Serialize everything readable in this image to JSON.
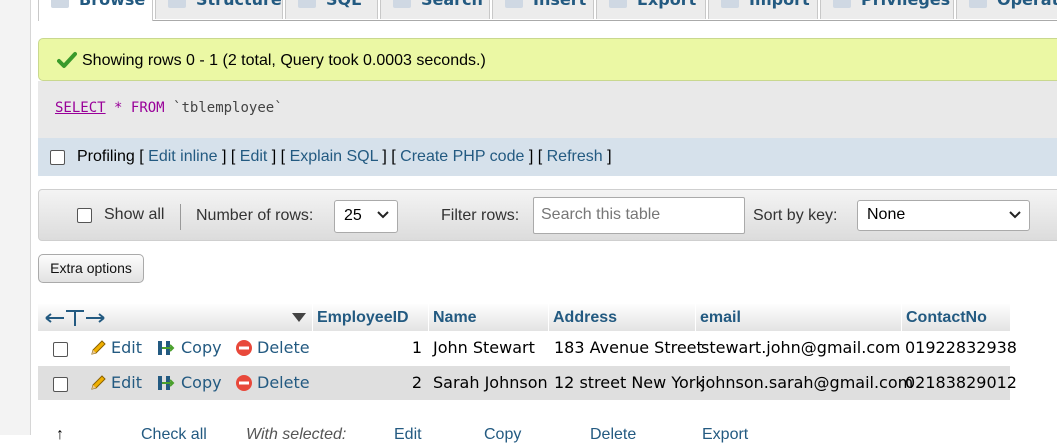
{
  "tabs": [
    {
      "label": "Browse",
      "active": true
    },
    {
      "label": "Structure"
    },
    {
      "label": "SQL"
    },
    {
      "label": "Search"
    },
    {
      "label": "Insert"
    },
    {
      "label": "Export"
    },
    {
      "label": "Import"
    },
    {
      "label": "Privileges"
    },
    {
      "label": "Operations"
    }
  ],
  "message": {
    "text": "Showing rows 0 - 1 (2 total, Query took 0.0003 seconds.)"
  },
  "query": {
    "select": "SELECT",
    "star": "*",
    "from": "FROM",
    "table": "`tblemployee`"
  },
  "profiling": {
    "label": "Profiling",
    "links": [
      "Edit inline",
      "Edit",
      "Explain SQL",
      "Create PHP code",
      "Refresh"
    ]
  },
  "nav": {
    "show_all": "Show all",
    "number_of_rows_label": "Number of rows:",
    "number_of_rows_value": "25",
    "filter_label": "Filter rows:",
    "filter_placeholder": "Search this table",
    "sort_label": "Sort by key:",
    "sort_value": "None"
  },
  "extra_options": "Extra options",
  "table": {
    "columns": [
      "EmployeeID",
      "Name",
      "Address",
      "email",
      "ContactNo"
    ],
    "actions": {
      "edit": "Edit",
      "copy": "Copy",
      "delete": "Delete"
    },
    "rows": [
      {
        "EmployeeID": "1",
        "Name": "John Stewart",
        "Address": "183 Avenue Street",
        "email": "stewart.john@gmail.com",
        "ContactNo": "01922832938"
      },
      {
        "EmployeeID": "2",
        "Name": "Sarah Johnson",
        "Address": "12 street New York",
        "email": "johnson.sarah@gmail.com",
        "ContactNo": "02183829012"
      }
    ]
  },
  "bottom_bar": {
    "check_all": "Check all",
    "with_selected": "With selected:",
    "edit": "Edit",
    "copy": "Copy",
    "delete": "Delete",
    "export": "Export"
  },
  "colors": {
    "link": "#235a81",
    "success_bg": "#ebf8a4",
    "profiling_bg": "#d6e1eb",
    "keyword": "#990099"
  }
}
